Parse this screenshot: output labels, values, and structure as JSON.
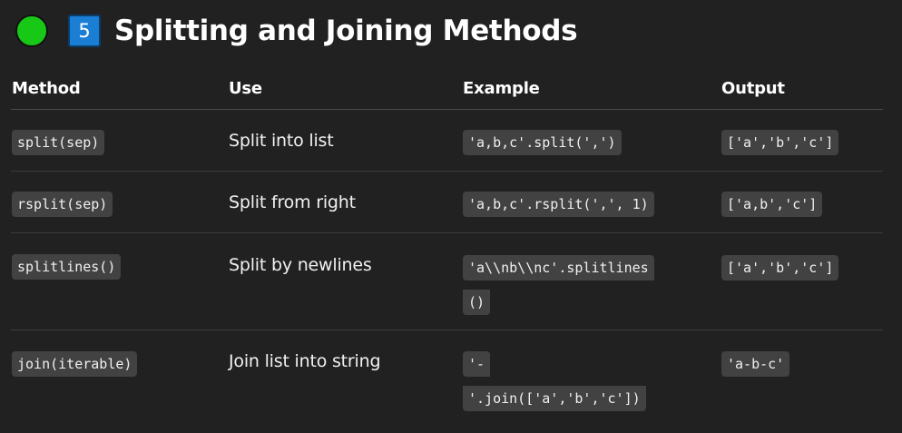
{
  "header": {
    "number": "5",
    "title": "Splitting and Joining Methods",
    "status_color": "#17c817",
    "keycap_color": "#1a7fd4"
  },
  "table": {
    "columns": [
      "Method",
      "Use",
      "Example",
      "Output"
    ],
    "rows": [
      {
        "method": "split(sep)",
        "use": "Split into list",
        "example_lines": [
          "'a,b,c'.split(',')"
        ],
        "output": "['a','b','c']"
      },
      {
        "method": "rsplit(sep)",
        "use": "Split from right",
        "example_lines": [
          "'a,b,c'.rsplit(',', 1)"
        ],
        "output": "['a,b','c']"
      },
      {
        "method": "splitlines()",
        "use": "Split by newlines",
        "example_lines": [
          "'a\\\\nb\\\\nc'.splitlines",
          "()"
        ],
        "output": "['a','b','c']"
      },
      {
        "method": "join(iterable)",
        "use": "Join list into string",
        "example_lines": [
          "'-",
          "'.join(['a','b','c'])"
        ],
        "output": "'a-b-c'"
      }
    ]
  }
}
